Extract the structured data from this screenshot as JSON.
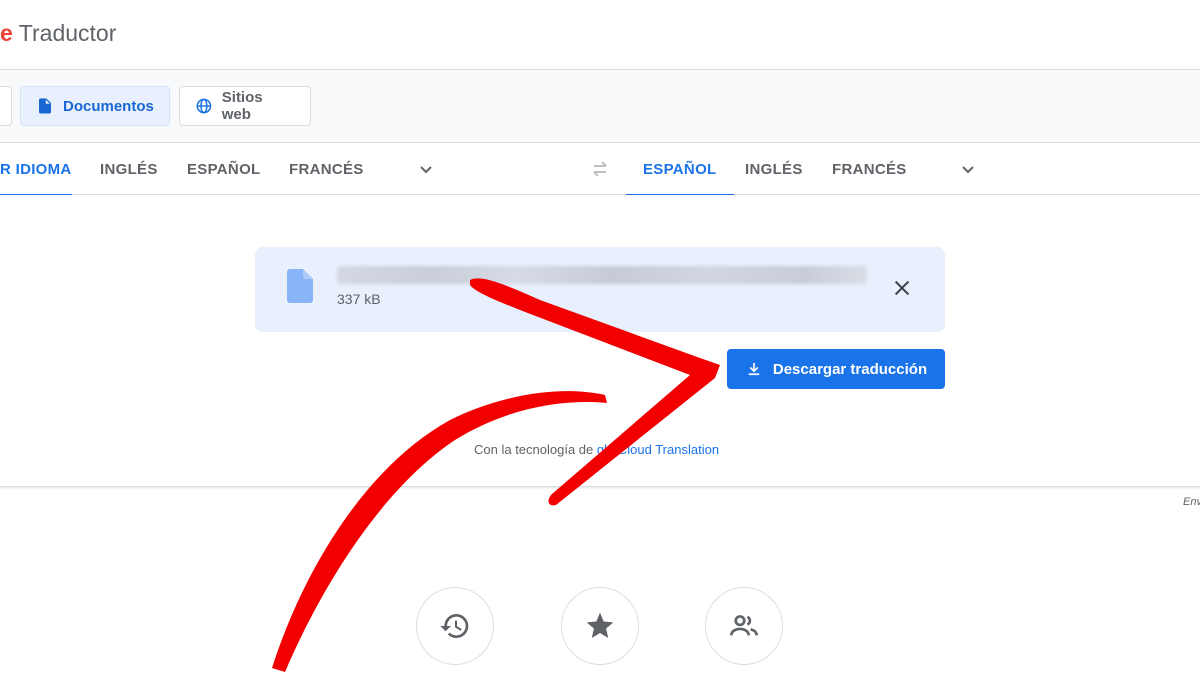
{
  "header": {
    "logo_letter": "e",
    "title": "Traductor"
  },
  "modes": {
    "documents_label": "Documentos",
    "websites_label": "Sitios web"
  },
  "source_langs": [
    "R IDIOMA",
    "INGLÉS",
    "ESPAÑOL",
    "FRANCÉS"
  ],
  "target_langs": [
    "ESPAÑOL",
    "INGLÉS",
    "FRANCÉS"
  ],
  "file": {
    "size": "337 kB"
  },
  "download_label": "Descargar traducción",
  "powered_by": {
    "prefix": "Con la tecnología de",
    "link": "Cloud Translation",
    "partial": "gle"
  },
  "side_note": "Env",
  "colors": {
    "accent": "#1a73e8",
    "accent_bg": "#e8f0fe",
    "arrow": "#f20000"
  }
}
